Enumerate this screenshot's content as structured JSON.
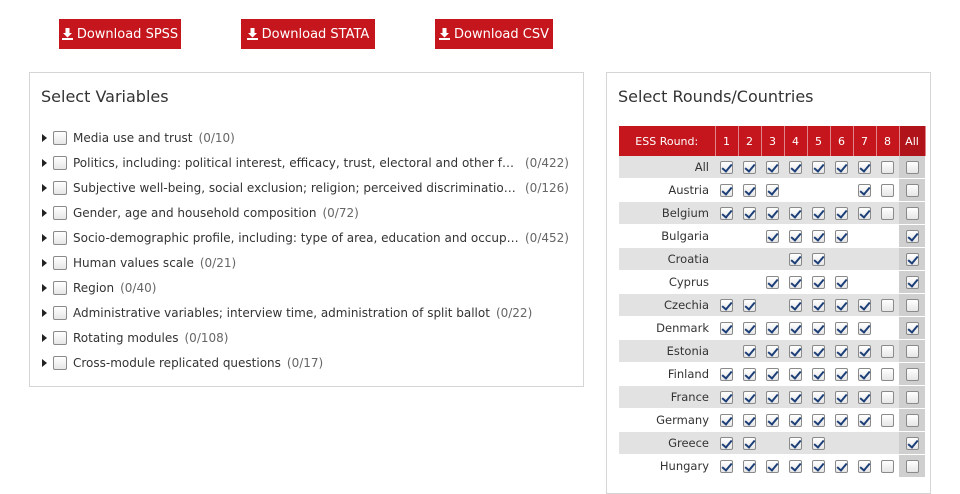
{
  "buttons": {
    "spss": "Download SPSS",
    "stata": "Download STATA",
    "csv": "Download CSV",
    "icon": "download-icon"
  },
  "variables_panel": {
    "title": "Select Variables",
    "items": [
      {
        "label": "Media use and trust",
        "count": "(0/10)"
      },
      {
        "label": "Politics, including: political interest, efficacy, trust, electoral and other forms of …",
        "count": "(0/422)"
      },
      {
        "label": "Subjective well-being, social exclusion; religion; perceived discrimination; natio…",
        "count": "(0/126)"
      },
      {
        "label": "Gender, age and household composition",
        "count": "(0/72)"
      },
      {
        "label": "Socio-demographic profile, including: type of area, education and occupation, u…",
        "count": "(0/452)"
      },
      {
        "label": "Human values scale",
        "count": "(0/21)"
      },
      {
        "label": "Region",
        "count": "(0/40)"
      },
      {
        "label": "Administrative variables; interview time, administration of split ballot",
        "count": "(0/22)"
      },
      {
        "label": "Rotating modules",
        "count": "(0/108)"
      },
      {
        "label": "Cross-module replicated questions",
        "count": "(0/17)"
      }
    ]
  },
  "rounds_panel": {
    "title": "Select Rounds/Countries",
    "header_label": "ESS Round:",
    "rounds": [
      "1",
      "2",
      "3",
      "4",
      "5",
      "6",
      "7",
      "8"
    ],
    "all_label": "All",
    "rows": [
      {
        "name": "All",
        "cells": [
          "c",
          "c",
          "c",
          "c",
          "c",
          "c",
          "c",
          "u"
        ],
        "all": "u"
      },
      {
        "name": "Austria",
        "cells": [
          "c",
          "c",
          "c",
          "-",
          "-",
          "-",
          "c",
          "u"
        ],
        "all": "u"
      },
      {
        "name": "Belgium",
        "cells": [
          "c",
          "c",
          "c",
          "c",
          "c",
          "c",
          "c",
          "u"
        ],
        "all": "u"
      },
      {
        "name": "Bulgaria",
        "cells": [
          "-",
          "-",
          "c",
          "c",
          "c",
          "c",
          "-",
          "-"
        ],
        "all": "c"
      },
      {
        "name": "Croatia",
        "cells": [
          "-",
          "-",
          "-",
          "c",
          "c",
          "-",
          "-",
          "-"
        ],
        "all": "c"
      },
      {
        "name": "Cyprus",
        "cells": [
          "-",
          "-",
          "c",
          "c",
          "c",
          "c",
          "-",
          "-"
        ],
        "all": "c"
      },
      {
        "name": "Czechia",
        "cells": [
          "c",
          "c",
          "-",
          "c",
          "c",
          "c",
          "c",
          "u"
        ],
        "all": "u"
      },
      {
        "name": "Denmark",
        "cells": [
          "c",
          "c",
          "c",
          "c",
          "c",
          "c",
          "c",
          "-"
        ],
        "all": "c"
      },
      {
        "name": "Estonia",
        "cells": [
          "-",
          "c",
          "c",
          "c",
          "c",
          "c",
          "c",
          "u"
        ],
        "all": "u"
      },
      {
        "name": "Finland",
        "cells": [
          "c",
          "c",
          "c",
          "c",
          "c",
          "c",
          "c",
          "u"
        ],
        "all": "u"
      },
      {
        "name": "France",
        "cells": [
          "c",
          "c",
          "c",
          "c",
          "c",
          "c",
          "c",
          "u"
        ],
        "all": "u"
      },
      {
        "name": "Germany",
        "cells": [
          "c",
          "c",
          "c",
          "c",
          "c",
          "c",
          "c",
          "u"
        ],
        "all": "u"
      },
      {
        "name": "Greece",
        "cells": [
          "c",
          "c",
          "-",
          "c",
          "c",
          "-",
          "-",
          "-"
        ],
        "all": "c"
      },
      {
        "name": "Hungary",
        "cells": [
          "c",
          "c",
          "c",
          "c",
          "c",
          "c",
          "c",
          "u"
        ],
        "all": "u"
      }
    ]
  },
  "colors": {
    "accent": "#c4161c",
    "check": "#1c3f78",
    "row_alt": "#e2e2e2"
  }
}
